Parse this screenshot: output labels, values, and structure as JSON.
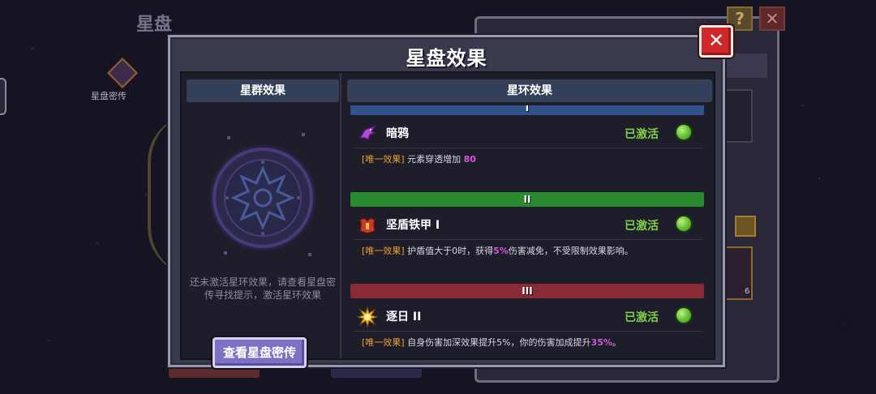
{
  "background": {
    "title": "星盘",
    "icon_label": "星盘密传",
    "help_glyph": "?",
    "close_glyph": "✕",
    "slot_count": "6",
    "colors": {
      "page": "#161422",
      "panel": "#2a2838"
    }
  },
  "modal": {
    "title": "星盘效果",
    "close_glyph": "✕",
    "left_header": "星群效果",
    "right_header": "星环效果",
    "hint": "还未激活星环效果，请查看星盘密传寻找提示，激活星环效果",
    "view_button": "查看星盘密传",
    "colors": {
      "frame": "#9a98b0",
      "body": "#1e1d2a",
      "header": "#34405a",
      "button": "#7e70c4",
      "close": "#d02828"
    }
  },
  "rings": [
    {
      "numeral": "I",
      "bar_color": "#34528a",
      "icon": "crow-icon",
      "name": "暗鸦",
      "status": "已激活",
      "tag": "[唯一效果]",
      "desc_before": "元素穿透增加",
      "highlight": "80",
      "desc_after": ""
    },
    {
      "numeral": "II",
      "bar_color": "#2a8a2e",
      "icon": "armor-icon",
      "name": "坚盾铁甲 I",
      "status": "已激活",
      "tag": "[唯一效果]",
      "desc_before": "护盾值大于0时，获得",
      "highlight": "5%",
      "desc_after": "伤害减免，不受限制效果影响。"
    },
    {
      "numeral": "III",
      "bar_color": "#8a2a34",
      "icon": "sun-icon",
      "name": "逐日 II",
      "status": "已激活",
      "tag": "[唯一效果]",
      "desc_before": "自身伤害加深效果提升5%，你的伤害加成提升",
      "highlight": "35%",
      "desc_after": "。"
    }
  ]
}
